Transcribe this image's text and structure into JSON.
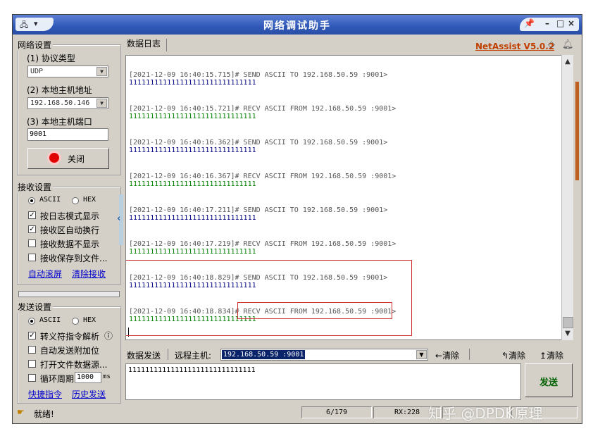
{
  "window": {
    "title": "网络调试助手",
    "version_link": "NetAssist V5.0.2"
  },
  "network": {
    "legend": "网络设置",
    "protocol_label": "(1) 协议类型",
    "protocol_value": "UDP",
    "host_label": "(2) 本地主机地址",
    "host_value": "192.168.50.146",
    "port_label": "(3) 本地主机端口",
    "port_value": "9001",
    "close_label": "关闭"
  },
  "receive": {
    "legend": "接收设置",
    "ascii": "ASCII",
    "hex": "HEX",
    "options": [
      {
        "label": "按日志模式显示",
        "checked": true
      },
      {
        "label": "接收区自动换行",
        "checked": true
      },
      {
        "label": "接收数据不显示",
        "checked": false
      },
      {
        "label": "接收保存到文件...",
        "checked": false
      }
    ],
    "auto_scroll": "自动滚屏",
    "clear_recv": "清除接收"
  },
  "send": {
    "legend": "发送设置",
    "ascii": "ASCII",
    "hex": "HEX",
    "escape_label": "转义符指令解析",
    "escape_info": "ⓘ",
    "auto_append": "自动发送附加位",
    "open_file": "打开文件数据源...",
    "loop_label": "循环周期",
    "loop_value": "1000",
    "loop_unit": "ms",
    "shortcut": "快捷指令",
    "history": "历史发送"
  },
  "log": {
    "tab": "数据日志",
    "entries": [
      {
        "header": "[2021-12-09 16:40:15.715]# SEND ASCII TO 192.168.50.59 :9001>",
        "payload": "111111111111111111111111111111",
        "dir": "send"
      },
      {
        "header": "[2021-12-09 16:40:15.721]# RECV ASCII FROM 192.168.50.59 :9001>",
        "payload": "111111111111111111111111111111",
        "dir": "recv"
      },
      {
        "header": "[2021-12-09 16:40:16.362]# SEND ASCII TO 192.168.50.59 :9001>",
        "payload": "111111111111111111111111111111",
        "dir": "send"
      },
      {
        "header": "[2021-12-09 16:40:16.367]# RECV ASCII FROM 192.168.50.59 :9001>",
        "payload": "111111111111111111111111111111",
        "dir": "recv"
      },
      {
        "header": "[2021-12-09 16:40:17.211]# SEND ASCII TO 192.168.50.59 :9001>",
        "payload": "111111111111111111111111111111",
        "dir": "send"
      },
      {
        "header": "[2021-12-09 16:40:17.219]# RECV ASCII FROM 192.168.50.59 :9001>",
        "payload": "111111111111111111111111111111",
        "dir": "recv"
      },
      {
        "header": "[2021-12-09 16:40:18.829]# SEND ASCII TO 192.168.50.59 :9001>",
        "payload": "111111111111111111111111111111",
        "dir": "send"
      },
      {
        "header": "[2021-12-09 16:40:18.834]# RECV ASCII FROM 192.168.50.59 :9001>",
        "payload": "111111111111111111111111111111",
        "dir": "recv"
      }
    ]
  },
  "sendbar": {
    "label": "数据发送",
    "remote_label": "远程主机:",
    "remote_value": "192.168.50.59 :9001",
    "clear1": "清除",
    "clear2": "清除",
    "clear3": "清除",
    "send_text": "111111111111111111111111111111",
    "send_button": "发送"
  },
  "status": {
    "ready": "就绪!",
    "count": "6/179",
    "rx": "RX:228"
  },
  "watermark": "知乎 @DPDK原理"
}
